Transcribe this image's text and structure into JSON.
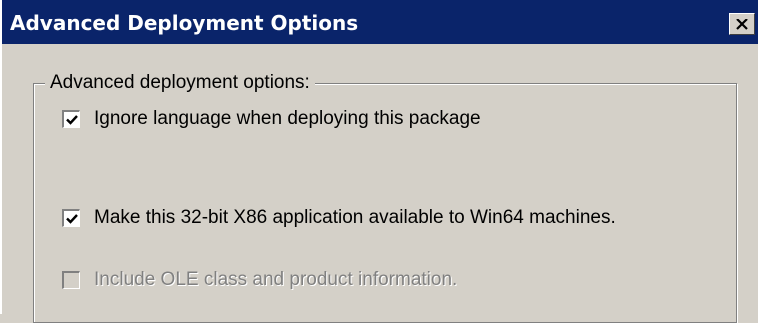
{
  "window": {
    "title": "Advanced Deployment Options",
    "close_icon": "close-icon"
  },
  "group": {
    "legend": "Advanced deployment options:"
  },
  "options": [
    {
      "label": "Ignore language when deploying this package",
      "checked": true,
      "enabled": true
    },
    {
      "label": "Make this 32-bit X86 application available to Win64 machines.",
      "checked": true,
      "enabled": true
    },
    {
      "label": "Include OLE class and product information.",
      "checked": false,
      "enabled": false
    }
  ],
  "colors": {
    "titlebar": "#0a246a",
    "face": "#d4d0c8",
    "disabled_text": "#808080"
  }
}
